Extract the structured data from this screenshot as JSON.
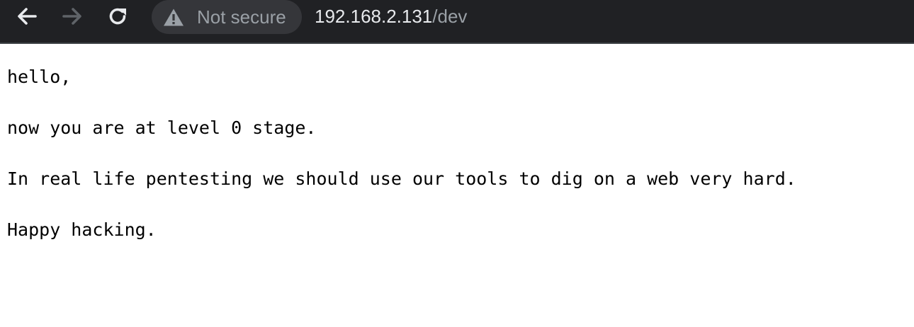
{
  "browser": {
    "toolbar": {
      "back_icon": "arrow-left",
      "forward_icon": "arrow-right",
      "reload_icon": "reload",
      "security_icon": "warning-triangle",
      "security_label": "Not secure",
      "url_host": "192.168.2.131",
      "url_path": "/dev"
    },
    "colors": {
      "toolbar_bg": "#202124",
      "chip_bg": "#35363a",
      "text_primary": "#e8eaed",
      "text_muted": "#9aa0a6",
      "forward_disabled": "#5f6368"
    }
  },
  "page": {
    "lines": [
      "hello,",
      "now you are at level 0 stage.",
      "In real life pentesting we should use our tools to dig on a web very hard.",
      "Happy hacking."
    ]
  }
}
